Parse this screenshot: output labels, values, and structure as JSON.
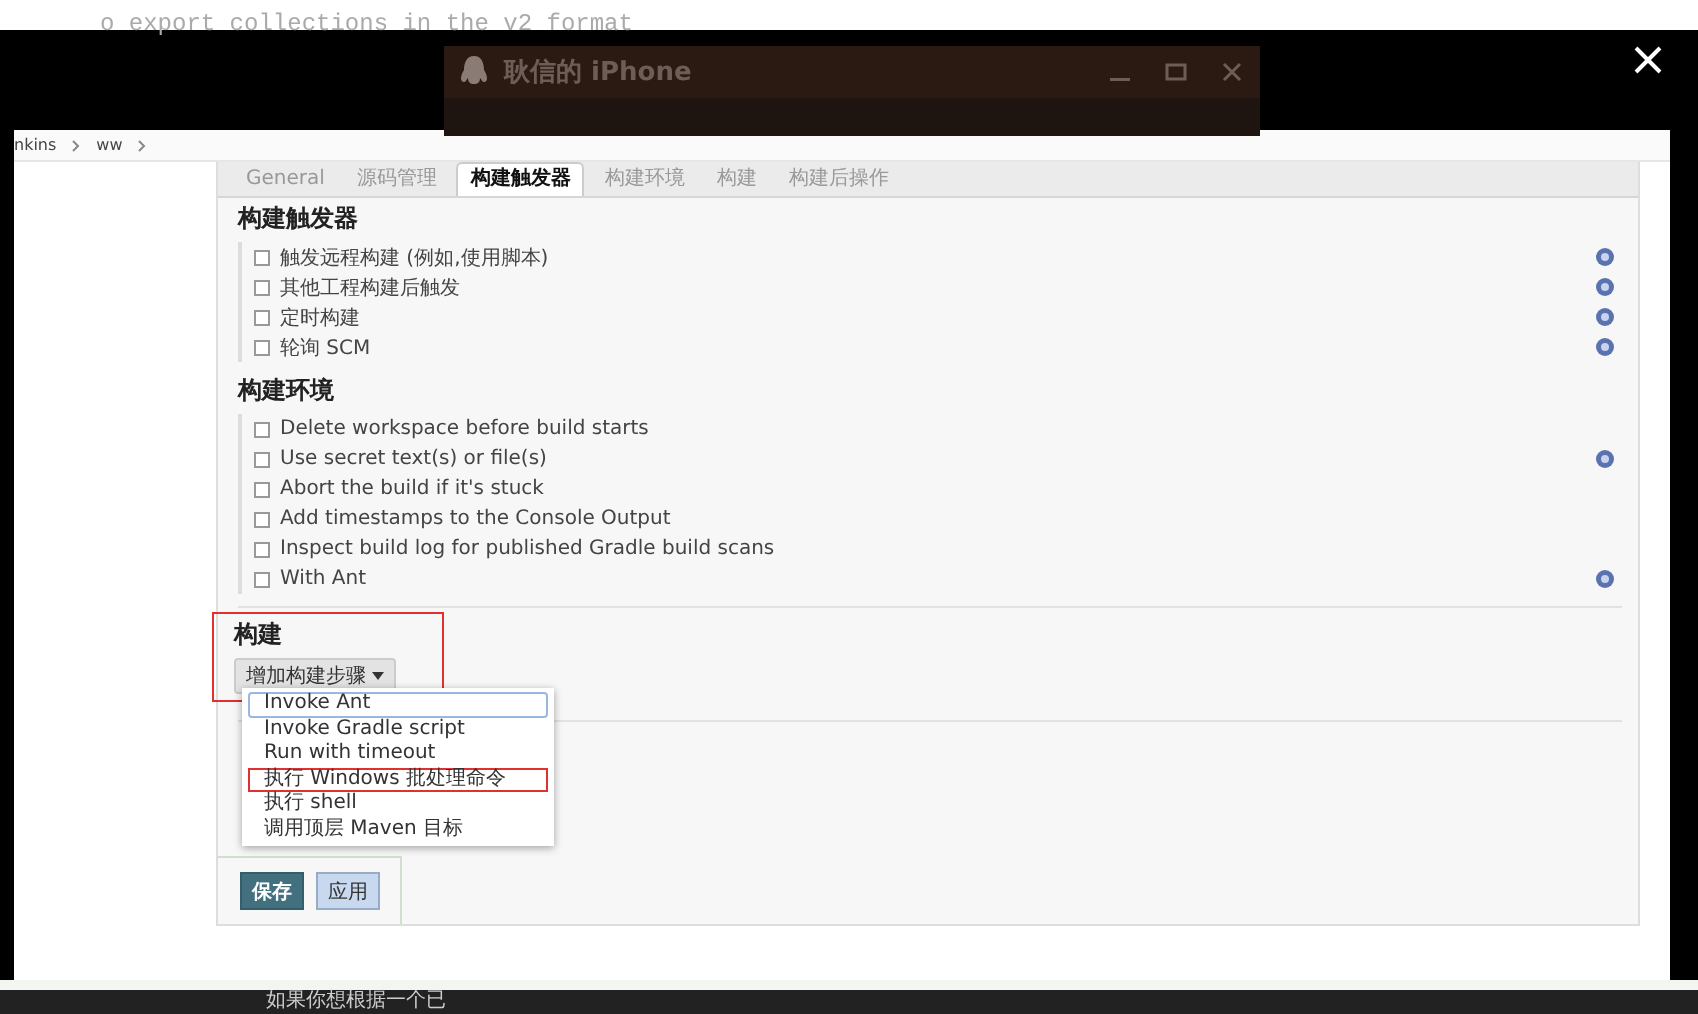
{
  "background_page": {
    "code_line": "o export collections in the v2 format",
    "footer_text": "如果你想根据一个已"
  },
  "background_window": {
    "title": "耿信的 iPhone"
  },
  "breadcrumb": [
    "nkins",
    "ww"
  ],
  "tabs": [
    {
      "label": "General",
      "selected": false
    },
    {
      "label": "源码管理",
      "selected": false
    },
    {
      "label": "构建触发器",
      "selected": true
    },
    {
      "label": "构建环境",
      "selected": false
    },
    {
      "label": "构建",
      "selected": false
    },
    {
      "label": "构建后操作",
      "selected": false
    }
  ],
  "sections": [
    {
      "title": "构建触发器",
      "options": [
        {
          "label": "触发远程构建 (例如,使用脚本)",
          "checked": false,
          "help": true
        },
        {
          "label": "其他工程构建后触发",
          "checked": false,
          "help": true
        },
        {
          "label": "定时构建",
          "checked": false,
          "help": true
        },
        {
          "label": "轮询 SCM",
          "checked": false,
          "help": true
        }
      ]
    },
    {
      "title": "构建环境",
      "options": [
        {
          "label": "Delete workspace before build starts",
          "checked": false,
          "help": false
        },
        {
          "label": "Use secret text(s) or file(s)",
          "checked": false,
          "help": true
        },
        {
          "label": "Abort the build if it's stuck",
          "checked": false,
          "help": false
        },
        {
          "label": "Add timestamps to the Console Output",
          "checked": false,
          "help": false
        },
        {
          "label": "Inspect build log for published Gradle build scans",
          "checked": false,
          "help": false
        },
        {
          "label": "With Ant",
          "checked": false,
          "help": true
        }
      ]
    }
  ],
  "build": {
    "title": "构建",
    "annotated": true,
    "add_step_button": "增加构建步骤",
    "menu": [
      {
        "label": "Invoke Ant",
        "selected": true,
        "annotated": false
      },
      {
        "label": "Invoke Gradle script",
        "selected": false,
        "annotated": false
      },
      {
        "label": "Run with timeout",
        "selected": false,
        "annotated": false
      },
      {
        "label": "执行 Windows 批处理命令",
        "selected": false,
        "annotated": true
      },
      {
        "label": "执行 shell",
        "selected": false,
        "annotated": false
      },
      {
        "label": "调用顶层 Maven 目标",
        "selected": false,
        "annotated": false
      }
    ]
  },
  "actions": [
    {
      "label": "保存",
      "kind": "primary"
    },
    {
      "label": "应用",
      "kind": "secondary"
    }
  ]
}
